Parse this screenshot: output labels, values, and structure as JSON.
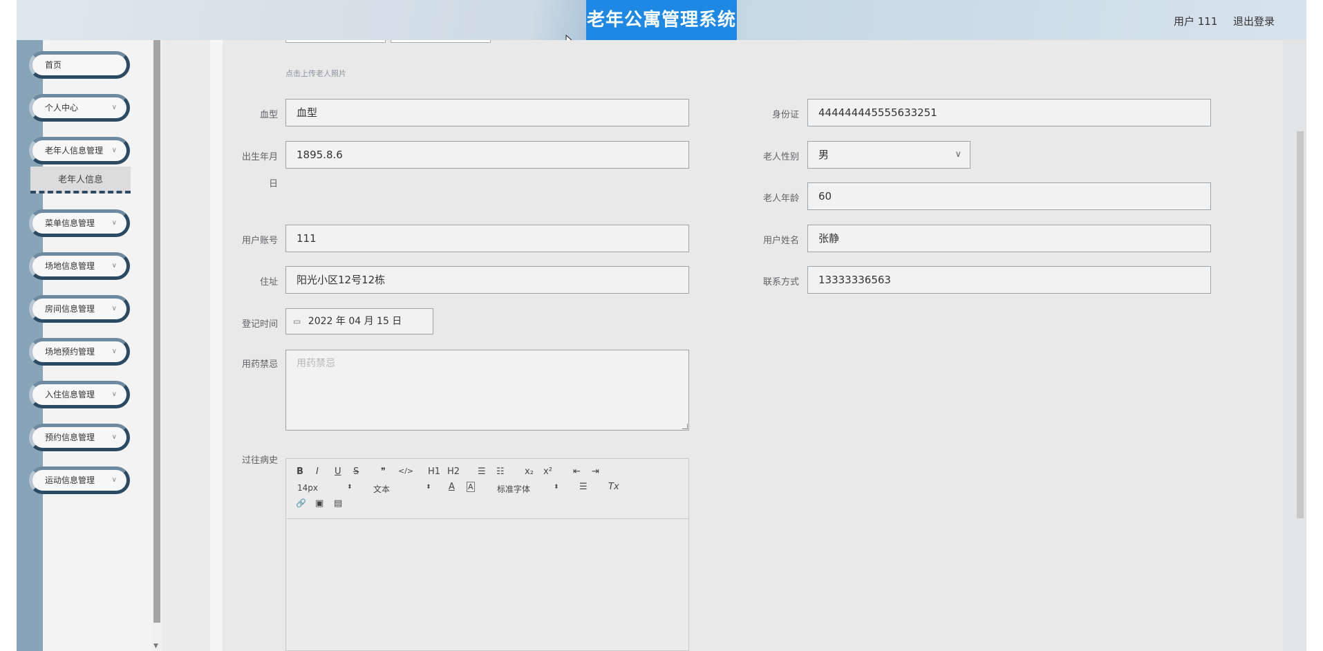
{
  "header": {
    "title": "老年公寓管理系统",
    "user": "用户 111",
    "logout": "退出登录"
  },
  "sidebar": {
    "items": [
      {
        "label": "首页",
        "has_arrow": false
      },
      {
        "label": "个人中心",
        "has_arrow": true
      },
      {
        "label": "老年人信息管理",
        "has_arrow": true
      },
      {
        "label": "菜单信息管理",
        "has_arrow": true
      },
      {
        "label": "场地信息管理",
        "has_arrow": true
      },
      {
        "label": "房间信息管理",
        "has_arrow": true
      },
      {
        "label": "场地预约管理",
        "has_arrow": true
      },
      {
        "label": "入住信息管理",
        "has_arrow": true
      },
      {
        "label": "预约信息管理",
        "has_arrow": true
      },
      {
        "label": "运动信息管理",
        "has_arrow": true
      }
    ],
    "subitem": "老年人信息",
    "chevron": "∨"
  },
  "form": {
    "upload_hint": "点击上传老人照片",
    "blood_type": {
      "label": "血型",
      "value": "血型"
    },
    "id_card": {
      "label": "身份证",
      "value": "444444445555633251"
    },
    "birth": {
      "label": "出生年月",
      "label2": "日",
      "value": "1895.8.6"
    },
    "gender": {
      "label": "老人性别",
      "value": "男"
    },
    "age": {
      "label": "老人年龄",
      "value": "60"
    },
    "account": {
      "label": "用户账号",
      "value": "111"
    },
    "name": {
      "label": "用户姓名",
      "value": "张静"
    },
    "address": {
      "label": "住址",
      "value": "阳光小区12号12栋"
    },
    "phone": {
      "label": "联系方式",
      "value": "13333336563"
    },
    "reg_time": {
      "label": "登记时间",
      "value": "2022 年 04 月 15 日"
    },
    "medicine": {
      "label": "用药禁忌",
      "placeholder": "用药禁忌"
    },
    "history": {
      "label": "过往病史"
    }
  },
  "editor": {
    "bold": "B",
    "italic": "I",
    "underline": "U",
    "strike": "S",
    "quote": "❞",
    "code": "</>",
    "h1": "H1",
    "h2": "H2",
    "ol": "☰",
    "ul": "☷",
    "sub": "x₂",
    "sup": "x²",
    "outdent": "⇤",
    "indent": "⇥",
    "size": "14px",
    "format": "文本",
    "color": "A",
    "bg": "A",
    "font": "标准字体",
    "align": "☰",
    "clear": "Tx",
    "link": "🔗",
    "image": "▣",
    "video": "▤",
    "updown": "⬍"
  },
  "icons": {
    "cursor": "cursor-icon",
    "calendar": "calendar-icon"
  },
  "colors": {
    "title_bg": "#1e88e5",
    "menu_border": "#2b4a63",
    "sidebar": "#87a4b8"
  }
}
